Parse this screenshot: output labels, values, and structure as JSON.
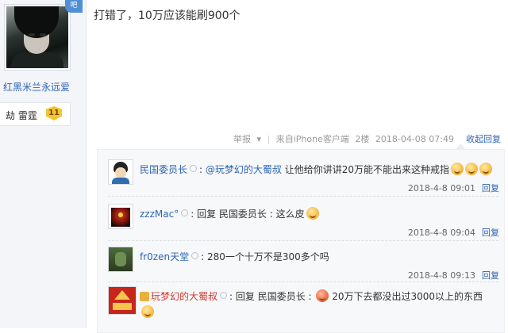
{
  "author": {
    "name": "红黑米兰永远爱",
    "level_name": "劫 雷霆",
    "level_number": "11",
    "badge": "吧"
  },
  "post": {
    "text": "打错了，10万应该能刷900个",
    "report_label": "举报",
    "source": "来自iPhone客户端",
    "floor": "2楼",
    "timestamp": "2018-04-08 07:49",
    "collapse_label": "收起回复"
  },
  "replies": [
    {
      "user": "民国委员长",
      "prefix": ":",
      "mention": "@玩梦幻的大蜀叔",
      "text": " 让他给你讲讲20万能不能出来这种戒指",
      "emoji_count": 3,
      "time": "2018-4-8 09:01",
      "reply_label": "回复"
    },
    {
      "user": "zzzMac°",
      "prefix": ":",
      "text": "回复 民国委员长 :  这么皮",
      "emoji_count": 1,
      "time": "2018-4-8 09:04",
      "reply_label": "回复"
    },
    {
      "user": "fr0zen天堂",
      "prefix": ":",
      "text": "280一个十万不是300多个吗",
      "emoji_count": 0,
      "time": "2018-4-8 09:13",
      "reply_label": "回复"
    },
    {
      "user": "玩梦幻的大蜀叔",
      "prefix": ":",
      "text": "回复 民国委员长 :",
      "text2": "20万下去都没出过3000以上的东西",
      "emoji_count": 1,
      "time": "",
      "reply_label": ""
    }
  ],
  "colors": {
    "link": "#2d64b3",
    "meta": "#999999",
    "reply_bg": "#f7f8fa"
  }
}
